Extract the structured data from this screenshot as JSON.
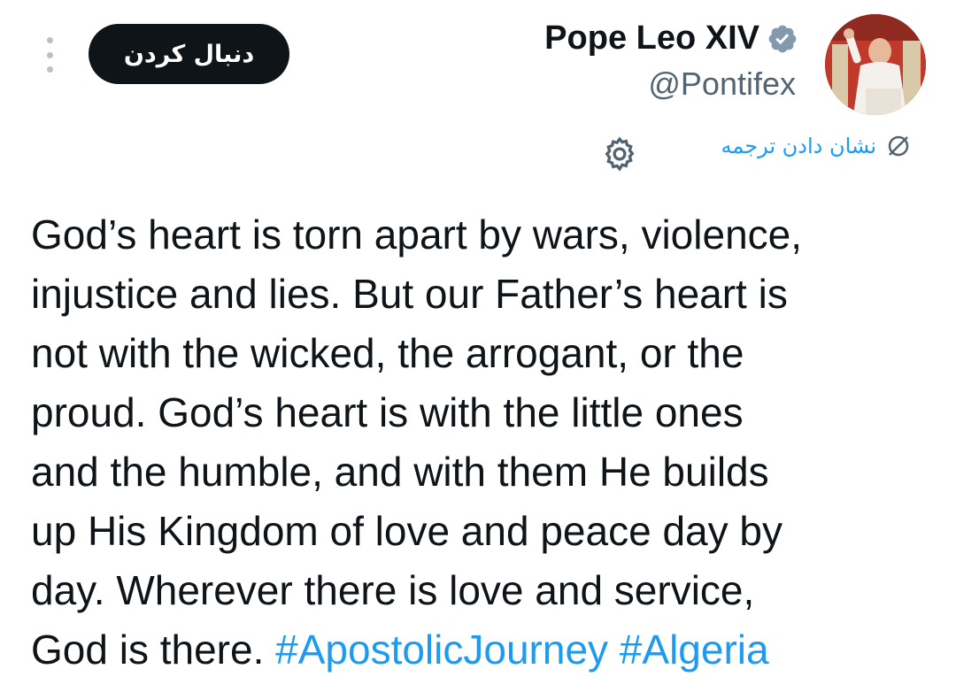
{
  "header": {
    "follow_label": "دنبال کردن",
    "display_name": "Pope Leo XIV",
    "handle": "@Pontifex",
    "verified_icon": "verified-badge-icon",
    "more_icon": "more-vertical-icon",
    "avatar_icon": "profile-avatar"
  },
  "translate": {
    "label": "نشان دادن ترجمه",
    "icon": "translate-icon",
    "settings_icon": "gear-icon"
  },
  "tweet": {
    "text": "God’s heart is torn apart by wars, violence,\ninjustice and lies. But our Father’s heart is\nnot with the wicked, the arrogant, or the\nproud. God’s heart is with the little ones\nand the humble, and with them He builds\nup His Kingdom of love and peace day by\nday. Wherever there is love and service,\nGod is there. ",
    "hashtags": [
      "#ApostolicJourney",
      "#Algeria"
    ]
  },
  "colors": {
    "accent": "#1d9bf0",
    "text": "#0f1419",
    "secondary": "#536471",
    "verified": "#829aab"
  }
}
